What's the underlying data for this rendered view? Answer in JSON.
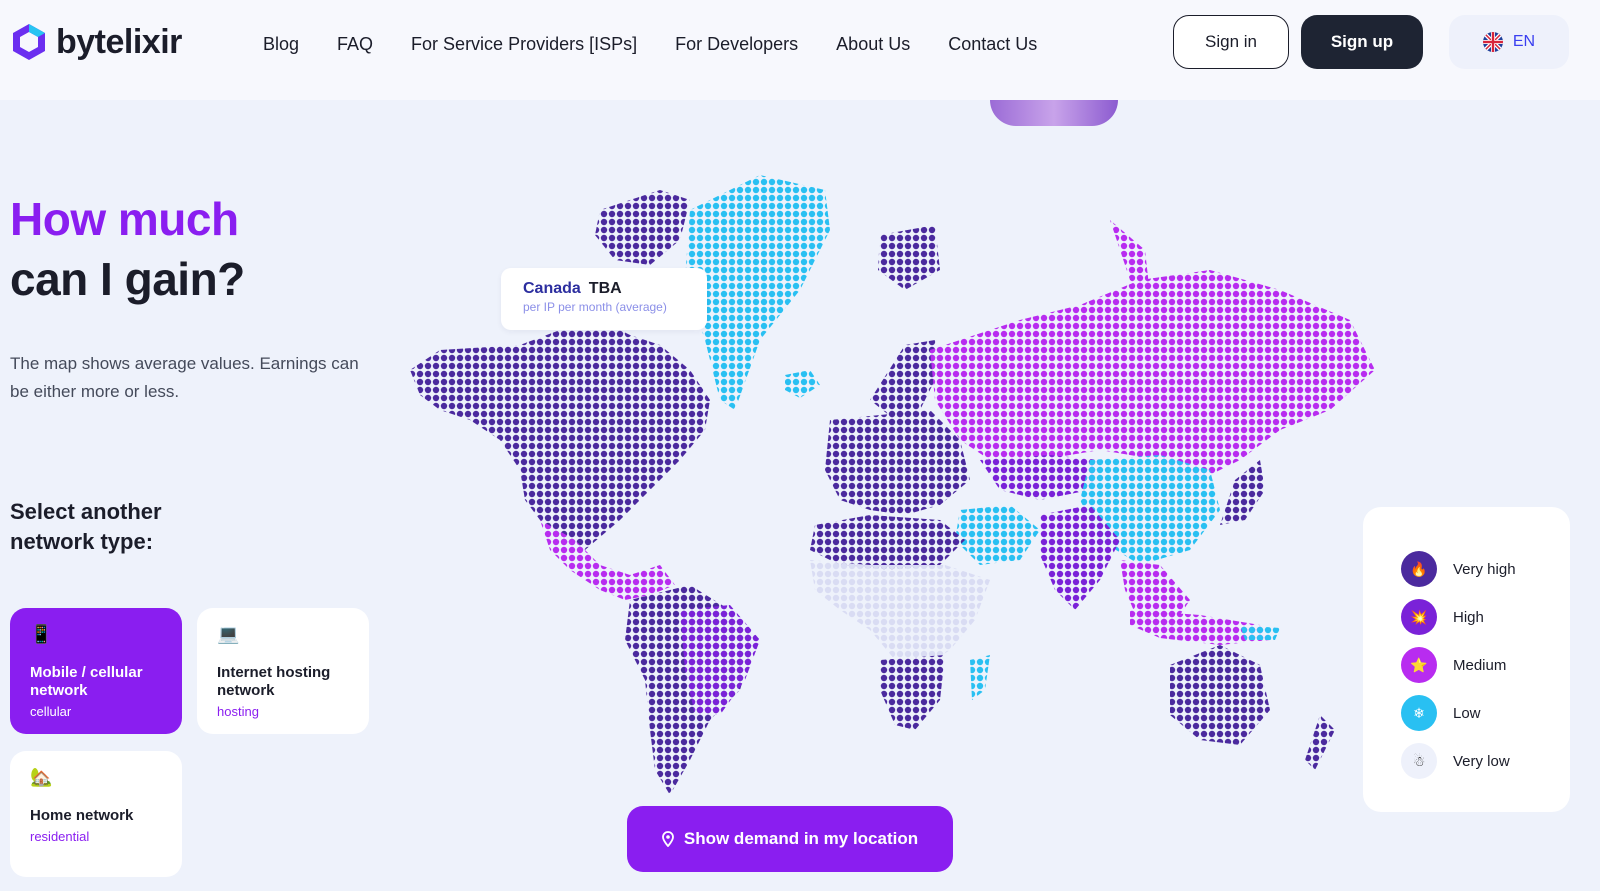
{
  "header": {
    "brand": "bytelixir",
    "nav": [
      "Blog",
      "FAQ",
      "For Service Providers [ISPs]",
      "For Developers",
      "About Us",
      "Contact Us"
    ],
    "sign_in": "Sign in",
    "sign_up": "Sign up",
    "language": "EN",
    "language_icon": "uk-flag-icon"
  },
  "hero": {
    "title_line1": "How much",
    "title_line2": "can I gain?",
    "description": "The map shows average values. Earnings can be either more or less.",
    "select_title": "Select another network type:"
  },
  "network_types": [
    {
      "icon": "📱",
      "title": "Mobile / cellular network",
      "subtitle": "cellular",
      "active": true
    },
    {
      "icon": "💻",
      "title": "Internet hosting network",
      "subtitle": "hosting",
      "active": false
    },
    {
      "icon": "🏡",
      "title": "Home network",
      "subtitle": "residential",
      "active": false
    }
  ],
  "tooltip": {
    "country": "Canada",
    "value": "TBA",
    "unit": "per IP per month (average)"
  },
  "demand_button": "Show demand in my location",
  "legend": [
    {
      "label": "Very high",
      "color": "#4b2a9e",
      "icon": "🔥"
    },
    {
      "label": "High",
      "color": "#7a22d8",
      "icon": "💥"
    },
    {
      "label": "Medium",
      "color": "#b82cf0",
      "icon": "⭐"
    },
    {
      "label": "Low",
      "color": "#29c0f2",
      "icon": "❄"
    },
    {
      "label": "Very low",
      "color": "#eef1fb",
      "icon": "☃"
    }
  ],
  "colors": {
    "accent": "#8a1ef0",
    "dark": "#1e2433",
    "very_high": "#4b2a9e",
    "high": "#7a22d8",
    "medium": "#b82cf0",
    "low": "#29c0f2",
    "very_low": "#d9dcf3"
  }
}
